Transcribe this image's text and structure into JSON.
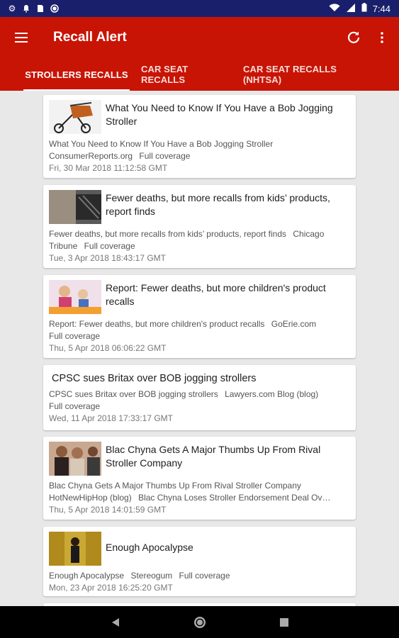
{
  "status_bar": {
    "time": "7:44",
    "icons": [
      "gear-icon",
      "bell-icon",
      "sim-icon",
      "circle-icon",
      "wifi-icon",
      "signal-icon",
      "battery-icon"
    ]
  },
  "app": {
    "title": "Recall Alert",
    "accent": "#c81405",
    "status_color": "#1a1f6b"
  },
  "tabs": [
    {
      "label": "STROLLERS RECALLS",
      "active": true
    },
    {
      "label": "CAR SEAT RECALLS",
      "active": false
    },
    {
      "label": "CAR SEAT RECALLS (NHTSA)",
      "active": false
    }
  ],
  "articles": [
    {
      "title": "What You Need to Know If You Have a Bob Jogging Stroller",
      "summary": "What You Need to Know If You Have a Bob Jogging Stroller",
      "source": "ConsumerReports.org",
      "extra": "Full coverage",
      "date": "Fri, 30 Mar 2018 11:12:58 GMT"
    },
    {
      "title": "Fewer deaths, but more recalls from kids’ products, report finds",
      "summary": "Fewer deaths, but more recalls from kids’ products, report finds",
      "source": "Chicago Tribune",
      "extra": "Full coverage",
      "date": "Tue, 3 Apr 2018 18:43:17 GMT"
    },
    {
      "title": "Report: Fewer deaths, but more children's product recalls",
      "summary": "Report: Fewer deaths, but more children's product recalls",
      "source": "GoErie.com",
      "extra": "Full coverage",
      "date": "Thu, 5 Apr 2018 06:06:22 GMT"
    },
    {
      "title": "CPSC sues Britax over BOB jogging strollers",
      "summary": "CPSC sues Britax over BOB jogging strollers",
      "source": "Lawyers.com Blog (blog)",
      "extra": "Full coverage",
      "date": "Wed, 11 Apr 2018 17:33:17 GMT"
    },
    {
      "title": "Blac Chyna Gets A Major Thumbs Up From Rival Stroller Company",
      "summary": "Blac Chyna Gets A Major Thumbs Up From Rival Stroller Company",
      "source": "HotNewHipHop (blog)",
      "extra": "Blac Chyna Loses Stroller Endorsement Deal Ov…",
      "date": "Thu, 5 Apr 2018 14:01:59 GMT"
    },
    {
      "title": "Enough Apocalypse",
      "summary": "Enough Apocalypse",
      "source": "Stereogum",
      "extra": "Full coverage",
      "date": "Mon, 23 Apr 2018 16:25:20 GMT"
    }
  ],
  "nav": {
    "icons": [
      "back-icon",
      "home-icon",
      "recents-icon"
    ]
  }
}
